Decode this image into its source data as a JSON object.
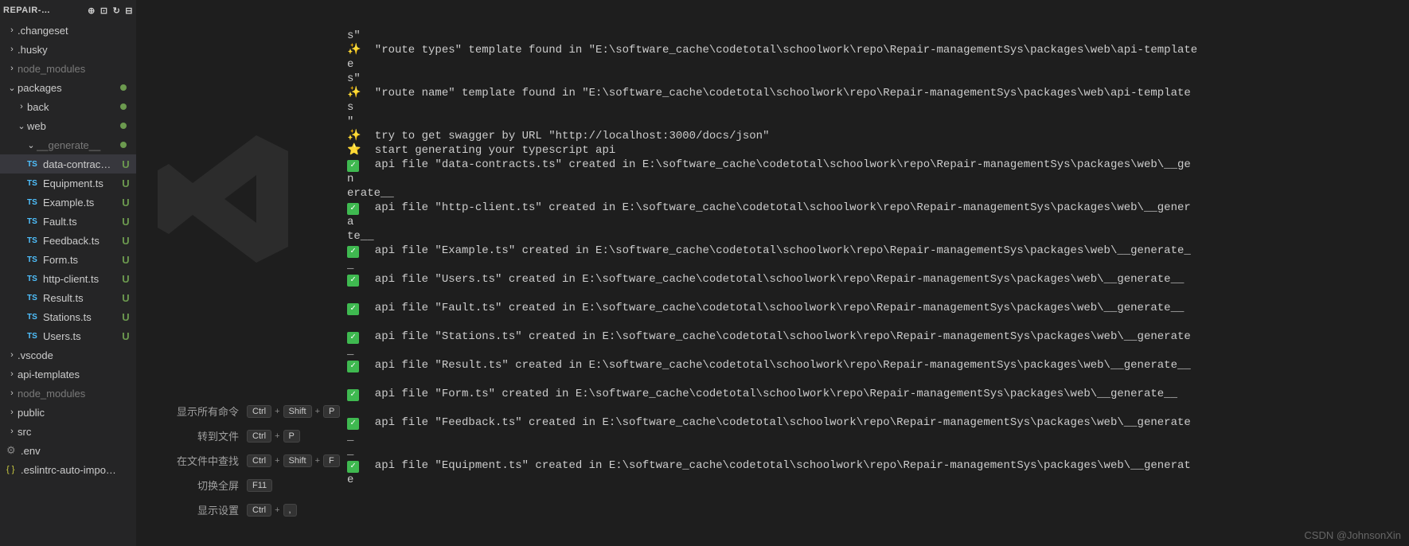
{
  "explorer": {
    "title": "REPAIR-…",
    "items": [
      {
        "label": ".changeset",
        "type": "folder",
        "collapsed": true,
        "indent": 1
      },
      {
        "label": ".husky",
        "type": "folder",
        "collapsed": true,
        "indent": 1
      },
      {
        "label": "node_modules",
        "type": "folder",
        "collapsed": true,
        "indent": 1,
        "dimmed": true
      },
      {
        "label": "packages",
        "type": "folder",
        "collapsed": false,
        "indent": 1,
        "dot": true
      },
      {
        "label": "back",
        "type": "folder",
        "collapsed": true,
        "indent": 2,
        "dot": true
      },
      {
        "label": "web",
        "type": "folder",
        "collapsed": false,
        "indent": 2,
        "dot": true
      },
      {
        "label": "__generate__",
        "type": "folder",
        "collapsed": false,
        "indent": 3,
        "dot": true,
        "dimmed": true
      },
      {
        "label": "data-contrac…",
        "type": "ts",
        "indent": 4,
        "badge": "U",
        "selected": true
      },
      {
        "label": "Equipment.ts",
        "type": "ts",
        "indent": 4,
        "badge": "U"
      },
      {
        "label": "Example.ts",
        "type": "ts",
        "indent": 4,
        "badge": "U"
      },
      {
        "label": "Fault.ts",
        "type": "ts",
        "indent": 4,
        "badge": "U"
      },
      {
        "label": "Feedback.ts",
        "type": "ts",
        "indent": 4,
        "badge": "U"
      },
      {
        "label": "Form.ts",
        "type": "ts",
        "indent": 4,
        "badge": "U"
      },
      {
        "label": "http-client.ts",
        "type": "ts",
        "indent": 4,
        "badge": "U"
      },
      {
        "label": "Result.ts",
        "type": "ts",
        "indent": 4,
        "badge": "U"
      },
      {
        "label": "Stations.ts",
        "type": "ts",
        "indent": 4,
        "badge": "U"
      },
      {
        "label": "Users.ts",
        "type": "ts",
        "indent": 4,
        "badge": "U"
      },
      {
        "label": ".vscode",
        "type": "folder",
        "collapsed": true,
        "indent": 1
      },
      {
        "label": "api-templates",
        "type": "folder",
        "collapsed": true,
        "indent": 1
      },
      {
        "label": "node_modules",
        "type": "folder",
        "collapsed": true,
        "indent": 1,
        "dimmed": true
      },
      {
        "label": "public",
        "type": "folder",
        "collapsed": true,
        "indent": 1
      },
      {
        "label": "src",
        "type": "folder",
        "collapsed": true,
        "indent": 1
      },
      {
        "label": ".env",
        "type": "gear",
        "indent": 1
      },
      {
        "label": ".eslintrc-auto-impo…",
        "type": "json",
        "indent": 1
      }
    ]
  },
  "commands": [
    {
      "label": "显示所有命令",
      "keys": [
        "Ctrl",
        "Shift",
        "P"
      ]
    },
    {
      "label": "转到文件",
      "keys": [
        "Ctrl",
        "P"
      ]
    },
    {
      "label": "在文件中查找",
      "keys": [
        "Ctrl",
        "Shift",
        "F"
      ]
    },
    {
      "label": "切换全屏",
      "keys": [
        "F11"
      ]
    },
    {
      "label": "显示设置",
      "keys": [
        "Ctrl",
        ","
      ]
    }
  ],
  "terminal": {
    "lines": [
      {
        "frag": "s\""
      },
      {
        "icon": "sparkle",
        "text": "  \"route types\" template found in \"E:\\software_cache\\codetotal\\schoolwork\\repo\\Repair-managementSys\\packages\\web\\api-template",
        "frags": [
          "e",
          "s\""
        ]
      },
      {
        "icon": "sparkle",
        "text": "  \"route name\" template found in \"E:\\software_cache\\codetotal\\schoolwork\\repo\\Repair-managementSys\\packages\\web\\api-template",
        "frags": [
          "s",
          "\""
        ]
      },
      {
        "icon": "sparkle",
        "text": "  try to get swagger by URL \"http://localhost:3000/docs/json\""
      },
      {
        "icon": "star",
        "text": "  start generating your typescript api"
      },
      {
        "icon": "check",
        "text": "  api file \"data-contracts.ts\" created in E:\\software_cache\\codetotal\\schoolwork\\repo\\Repair-managementSys\\packages\\web\\__ge",
        "frags": [
          "n",
          "erate__"
        ]
      },
      {
        "icon": "check",
        "text": "  api file \"http-client.ts\" created in E:\\software_cache\\codetotal\\schoolwork\\repo\\Repair-managementSys\\packages\\web\\__gener",
        "frags": [
          "a",
          "te__"
        ]
      },
      {
        "icon": "check",
        "text": "  api file \"Example.ts\" created in E:\\software_cache\\codetotal\\schoolwork\\repo\\Repair-managementSys\\packages\\web\\__generate_",
        "frags": [
          "_"
        ]
      },
      {
        "icon": "check",
        "text": "  api file \"Users.ts\" created in E:\\software_cache\\codetotal\\schoolwork\\repo\\Repair-managementSys\\packages\\web\\__generate__"
      },
      {
        "blank": true
      },
      {
        "icon": "check",
        "text": "  api file \"Fault.ts\" created in E:\\software_cache\\codetotal\\schoolwork\\repo\\Repair-managementSys\\packages\\web\\__generate__"
      },
      {
        "blank": true
      },
      {
        "icon": "check",
        "text": "  api file \"Stations.ts\" created in E:\\software_cache\\codetotal\\schoolwork\\repo\\Repair-managementSys\\packages\\web\\__generate",
        "frags": [
          "_"
        ]
      },
      {
        "icon": "check",
        "text": "  api file \"Result.ts\" created in E:\\software_cache\\codetotal\\schoolwork\\repo\\Repair-managementSys\\packages\\web\\__generate__"
      },
      {
        "blank": true
      },
      {
        "icon": "check",
        "text": "  api file \"Form.ts\" created in E:\\software_cache\\codetotal\\schoolwork\\repo\\Repair-managementSys\\packages\\web\\__generate__"
      },
      {
        "blank": true
      },
      {
        "icon": "check",
        "text": "  api file \"Feedback.ts\" created in E:\\software_cache\\codetotal\\schoolwork\\repo\\Repair-managementSys\\packages\\web\\__generate",
        "frags": [
          "_",
          "_"
        ]
      },
      {
        "icon": "check",
        "text": "  api file \"Equipment.ts\" created in E:\\software_cache\\codetotal\\schoolwork\\repo\\Repair-managementSys\\packages\\web\\__generat",
        "frags": [
          "e"
        ]
      }
    ]
  },
  "watermark": "CSDN @JohnsonXin"
}
